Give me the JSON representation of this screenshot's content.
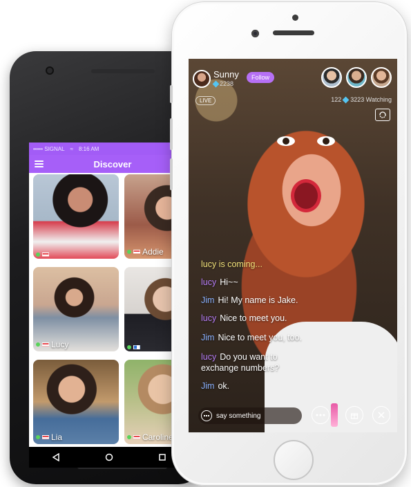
{
  "android": {
    "status": {
      "carrier": "••••• SIGNAL",
      "time": "8:16 AM"
    },
    "appbar": {
      "title": "Discover"
    },
    "tiles": [
      {
        "name": "",
        "online": true
      },
      {
        "name": "Addie",
        "online": true
      },
      {
        "name": "Lucy",
        "online": true
      },
      {
        "name": "",
        "online": true
      },
      {
        "name": "Lia",
        "online": true
      },
      {
        "name": "Caroline",
        "online": true
      }
    ]
  },
  "iphone": {
    "host": {
      "name": "Sunny",
      "diamonds": "2238",
      "follow_label": "Follow"
    },
    "live_label": "LIVE",
    "stats": {
      "diamonds": "122",
      "watching": "3223 Watching"
    },
    "chat": [
      {
        "name": "",
        "text": "lucy is coming...",
        "kind": "system"
      },
      {
        "name": "lucy",
        "text": "Hi~~",
        "kind": "lucy"
      },
      {
        "name": "Jim",
        "text": "Hi! My name is Jake.",
        "kind": "jim"
      },
      {
        "name": "lucy",
        "text": "Nice to meet you.",
        "kind": "lucy"
      },
      {
        "name": "Jim",
        "text": "Nice to meet you, too.",
        "kind": "jim"
      },
      {
        "name": "lucy",
        "text": "Do you want to",
        "kind": "lucy"
      },
      {
        "name": "",
        "text": "exchange numbers?",
        "kind": "cont"
      },
      {
        "name": "Jim",
        "text": "ok.",
        "kind": "jim"
      }
    ],
    "input": {
      "placeholder": "say something"
    }
  },
  "colors": {
    "accent": "#a65ff8",
    "lucy": "#b57cf5",
    "jim": "#8ab1ff",
    "system": "#f2e27a"
  },
  "icons": [
    "menu-icon",
    "wifi-icon",
    "back-icon",
    "home-icon",
    "recents-icon",
    "diamond-icon",
    "switch-camera-icon",
    "chat-icon",
    "more-icon",
    "gift-icon",
    "close-icon"
  ]
}
